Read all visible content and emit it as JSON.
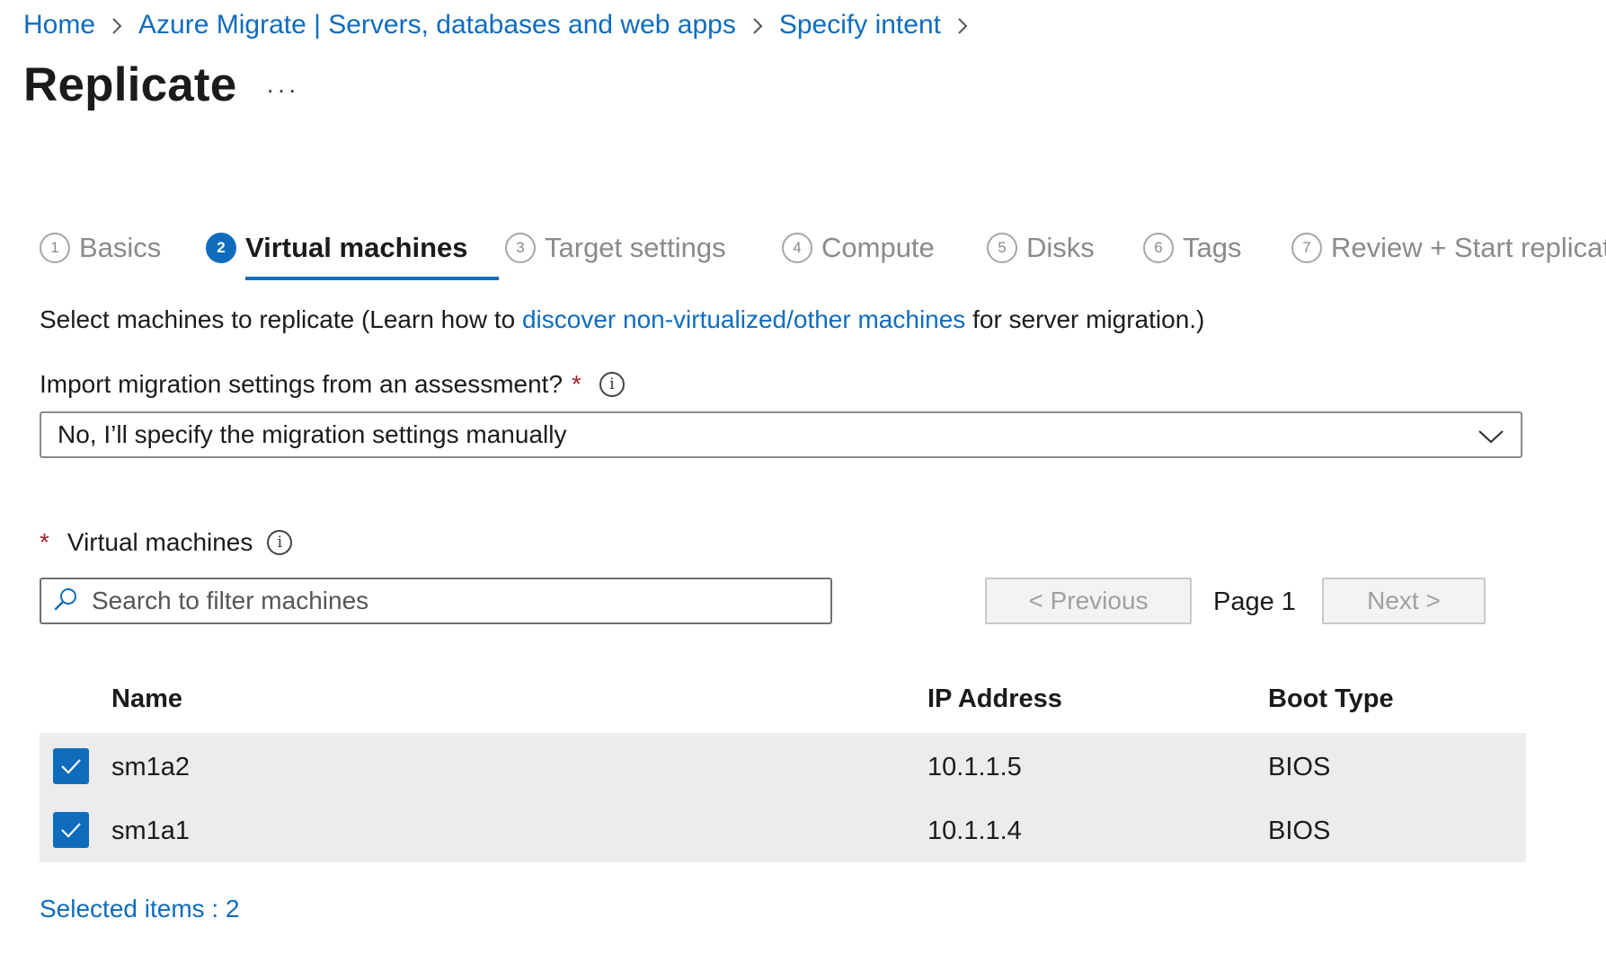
{
  "breadcrumb": {
    "items": [
      "Home",
      "Azure Migrate | Servers, databases and web apps",
      "Specify intent"
    ]
  },
  "page": {
    "title": "Replicate",
    "more_label": "···"
  },
  "steps": [
    {
      "num": "1",
      "label": "Basics"
    },
    {
      "num": "2",
      "label": "Virtual machines"
    },
    {
      "num": "3",
      "label": "Target settings"
    },
    {
      "num": "4",
      "label": "Compute"
    },
    {
      "num": "5",
      "label": "Disks"
    },
    {
      "num": "6",
      "label": "Tags"
    },
    {
      "num": "7",
      "label": "Review + Start replicat"
    }
  ],
  "description": {
    "prefix": "Select machines to replicate (Learn how to ",
    "link": "discover non-virtualized/other machines",
    "suffix": " for server migration.)"
  },
  "import_settings": {
    "label": "Import migration settings from an assessment?",
    "required_mark": "*",
    "info_icon": "info-icon",
    "selected_value": "No, I’ll specify the migration settings manually"
  },
  "virtual_machines": {
    "required_mark": "*",
    "label": "Virtual machines",
    "search_placeholder": "Search to filter machines",
    "pager": {
      "previous_label": "< Previous",
      "page_label": "Page 1",
      "next_label": "Next >"
    }
  },
  "table": {
    "columns": [
      "Name",
      "IP Address",
      "Boot Type"
    ],
    "rows": [
      {
        "name": "sm1a2",
        "ip": "10.1.1.5",
        "boot": "BIOS",
        "checked": true
      },
      {
        "name": "sm1a1",
        "ip": "10.1.1.4",
        "boot": "BIOS",
        "checked": true
      }
    ]
  },
  "selected_items_label": "Selected items : 2",
  "colors": {
    "accent": "#0f6cbd",
    "required": "#a4262c",
    "row_background": "#ececec"
  }
}
